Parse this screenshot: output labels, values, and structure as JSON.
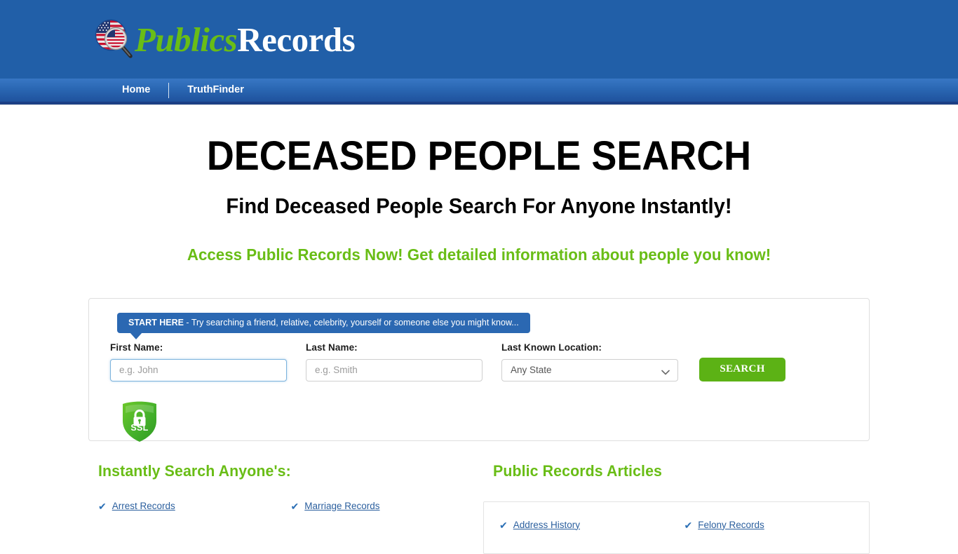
{
  "header": {
    "logo_icon": "usa-flag-magnifier-icon",
    "logo_part1": "Publics",
    "logo_part2": "Records",
    "brand_green": "#69bd16",
    "brand_blue": "#215fa8"
  },
  "nav": {
    "items": [
      {
        "label": "Home"
      },
      {
        "label": "TruthFinder"
      }
    ]
  },
  "hero": {
    "title": "DECEASED PEOPLE SEARCH",
    "subtitle": "Find Deceased People Search For Anyone Instantly!",
    "tagline": "Access Public Records Now! Get detailed information about people you know!"
  },
  "search": {
    "badge_bold": "START HERE",
    "badge_rest": " - Try searching a friend, relative, celebrity, yourself or someone else you might know...",
    "first_name_label": "First Name:",
    "first_name_value": "",
    "first_name_placeholder": "e.g. John",
    "last_name_label": "Last Name:",
    "last_name_value": "",
    "last_name_placeholder": "e.g. Smith",
    "location_label": "Last Known Location:",
    "location_selected": "Any State",
    "button_label": "SEARCH",
    "ssl_label": "SSL",
    "ssl_icon": "padlock-shield-icon",
    "button_color": "#5cb215"
  },
  "left_column": {
    "heading": "Instantly Search Anyone's:",
    "links": [
      {
        "label": "Arrest Records"
      },
      {
        "label": "Marriage Records"
      }
    ]
  },
  "right_column": {
    "heading": "Public Records Articles",
    "links": [
      {
        "label": "Address History"
      },
      {
        "label": "Felony Records"
      }
    ]
  }
}
